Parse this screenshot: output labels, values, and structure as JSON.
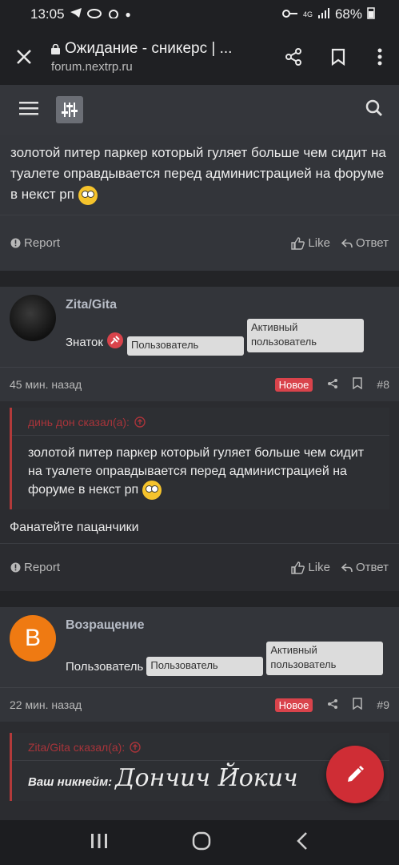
{
  "status_bar": {
    "time": "13:05",
    "signal_label": "4G",
    "battery": "68%"
  },
  "browser": {
    "title": "Ожидание - сникерс | ...",
    "url": "forum.nextrp.ru"
  },
  "colors": {
    "accent": "#cf2d35",
    "new_badge": "#d9434b",
    "quote_border": "#b23a3a"
  },
  "post_top": {
    "text": "золотой питер паркер который гуляет больше чем сидит на туалете оправдывается перед администрацией на форуме в некст рп",
    "report": "Report",
    "like": "Like",
    "reply": "Ответ"
  },
  "post8": {
    "username": "Zita/Gita",
    "rank": "Знаток",
    "banner1": "Пользователь",
    "banner2": "Активный пользователь",
    "time": "45 мин. назад",
    "badge": "Новое",
    "number": "#8",
    "quote_author": "динь дон сказал(а):",
    "quote_text": "золотой питер паркер который гуляет больше чем сидит на туалете оправдывается перед администрацией на форуме в некст рп",
    "text": "Фанатейте пацанчики",
    "report": "Report",
    "like": "Like",
    "reply": "Ответ"
  },
  "post9": {
    "avatar_letter": "B",
    "username": "Возращение",
    "rank": "Пользователь",
    "banner1": "Пользователь",
    "banner2": "Активный пользователь",
    "time": "22 мин. назад",
    "badge": "Новое",
    "number": "#9",
    "quote_author": "Zita/Gita сказал(а):",
    "nickname_label": "Ваш никнейм:",
    "nickname_value": "Дончич Йокич"
  }
}
